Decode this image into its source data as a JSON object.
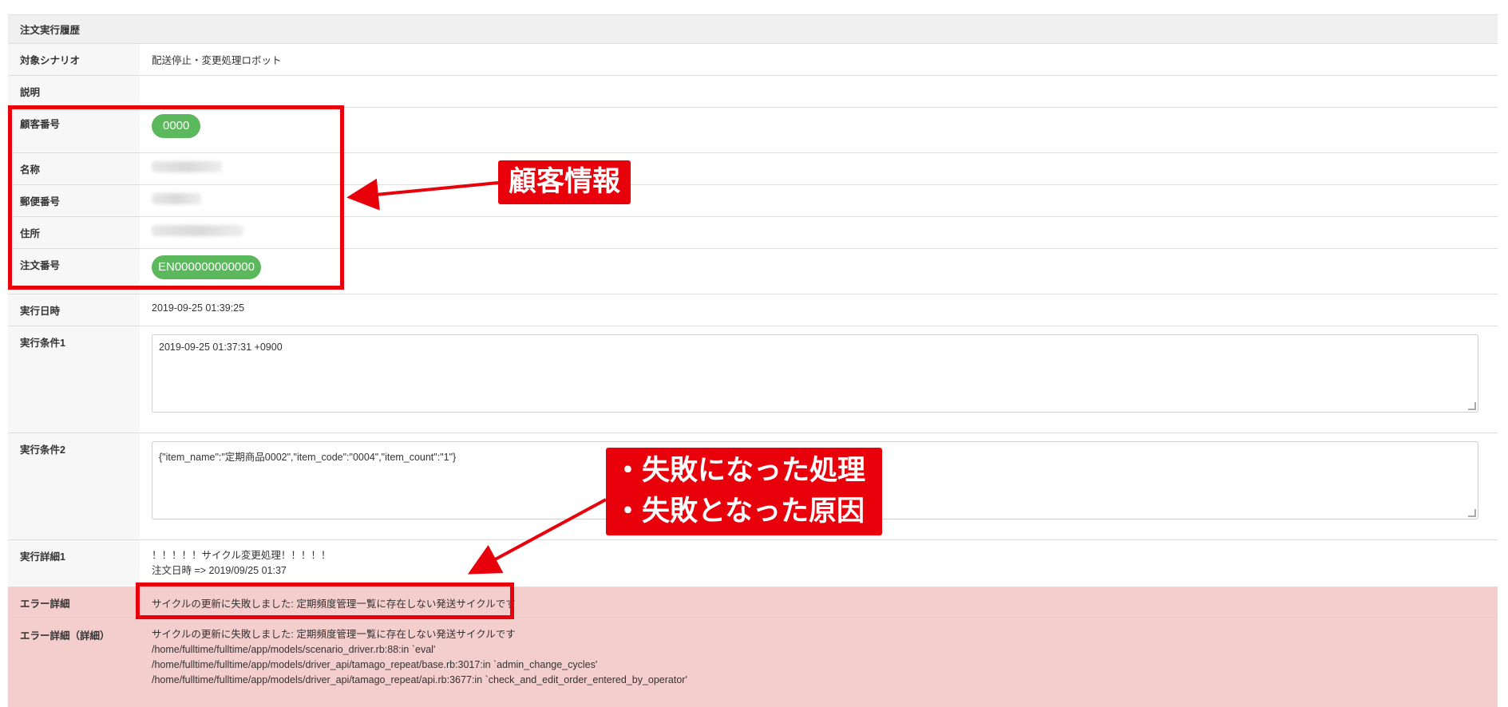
{
  "table": {
    "title": "注文実行履歴",
    "rows": {
      "scenario": {
        "label": "対象シナリオ",
        "value": "配送停止・変更処理ロボット"
      },
      "description": {
        "label": "説明",
        "value": ""
      },
      "customer_no": {
        "label": "顧客番号",
        "value": "0000"
      },
      "name": {
        "label": "名称"
      },
      "postal": {
        "label": "郵便番号"
      },
      "address": {
        "label": "住所"
      },
      "order_no": {
        "label": "注文番号",
        "value": "EN000000000000"
      },
      "exec_datetime": {
        "label": "実行日時",
        "value": "2019-09-25 01:39:25"
      },
      "cond1": {
        "label": "実行条件1",
        "value": "2019-09-25 01:37:31 +0900"
      },
      "cond2": {
        "label": "実行条件2",
        "value": "{\"item_name\":\"定期商品0002\",\"item_code\":\"0004\",\"item_count\":\"1\"}"
      },
      "detail1": {
        "label": "実行詳細1",
        "lines": [
          "！！！！！サイクル変更処理！！！！！",
          "注文日時 => 2019/09/25 01:37"
        ]
      },
      "error": {
        "label": "エラー詳細",
        "value": "サイクルの更新に失敗しました: 定期頻度管理一覧に存在しない発送サイクルです"
      },
      "error_full": {
        "label": "エラー詳細（詳細）",
        "lines": [
          "サイクルの更新に失敗しました: 定期頻度管理一覧に存在しない発送サイクルです",
          "/home/fulltime/fulltime/app/models/scenario_driver.rb:88:in `eval'",
          "/home/fulltime/fulltime/app/models/driver_api/tamago_repeat/base.rb:3017:in `admin_change_cycles'",
          "/home/fulltime/fulltime/app/models/driver_api/tamago_repeat/api.rb:3677:in `check_and_edit_order_entered_by_operator'"
        ]
      }
    }
  },
  "annotations": {
    "customer_info": "顧客情報",
    "failure_lines": [
      "・失敗になった処理",
      "・失敗となった原因"
    ]
  },
  "colors": {
    "annotation_red": "#e8000b",
    "badge_green": "#5cb85c",
    "error_bg": "#f4cdcd"
  }
}
